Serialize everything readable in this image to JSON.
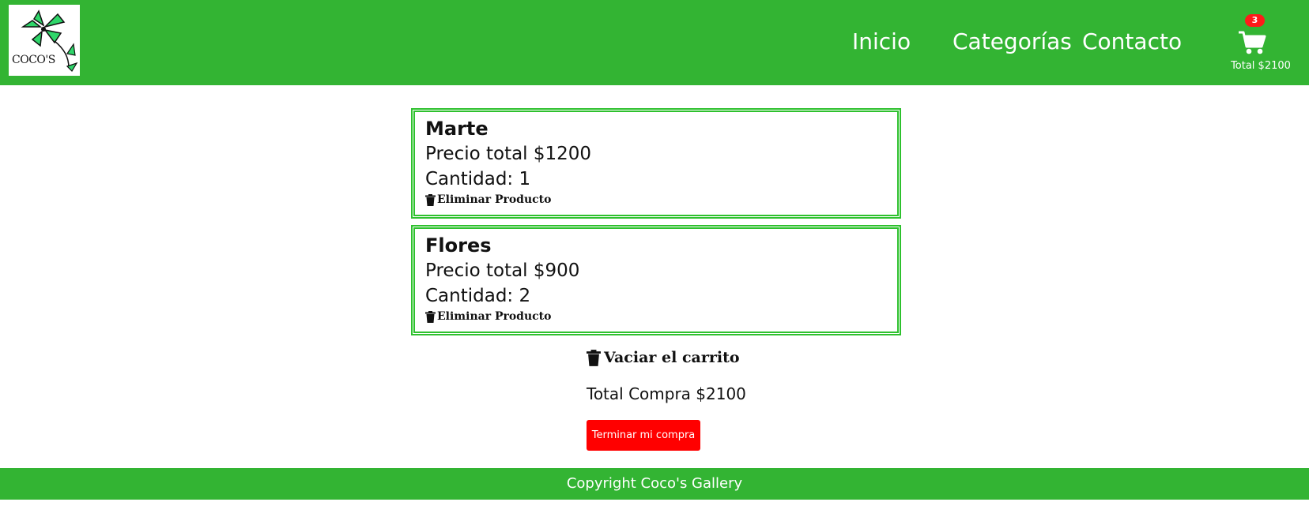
{
  "header": {
    "logo_text": "COCO'S",
    "nav": [
      "Inicio",
      "Categorías",
      "Contacto"
    ],
    "cart": {
      "count": "3",
      "total_label": "Total $2100",
      "icon": "shopping-cart-icon"
    }
  },
  "products": [
    {
      "name": "Marte",
      "price": "Precio total $1200",
      "quantity": "Cantidad: 1",
      "remove_label": "Eliminar Producto"
    },
    {
      "name": "Flores",
      "price": "Precio total $900",
      "quantity": "Cantidad: 2",
      "remove_label": "Eliminar Producto"
    }
  ],
  "cart_actions": {
    "empty_label": "Vaciar el carrito",
    "total_label": "Total Compra $2100",
    "finish_label": "Terminar mi compra"
  },
  "footer": {
    "text": "Copyright Coco's Gallery"
  },
  "colors": {
    "brand_green": "#33b433",
    "card_border": "#2ec12e",
    "badge_red": "#ff1a1a",
    "button_red": "#ff0000"
  }
}
